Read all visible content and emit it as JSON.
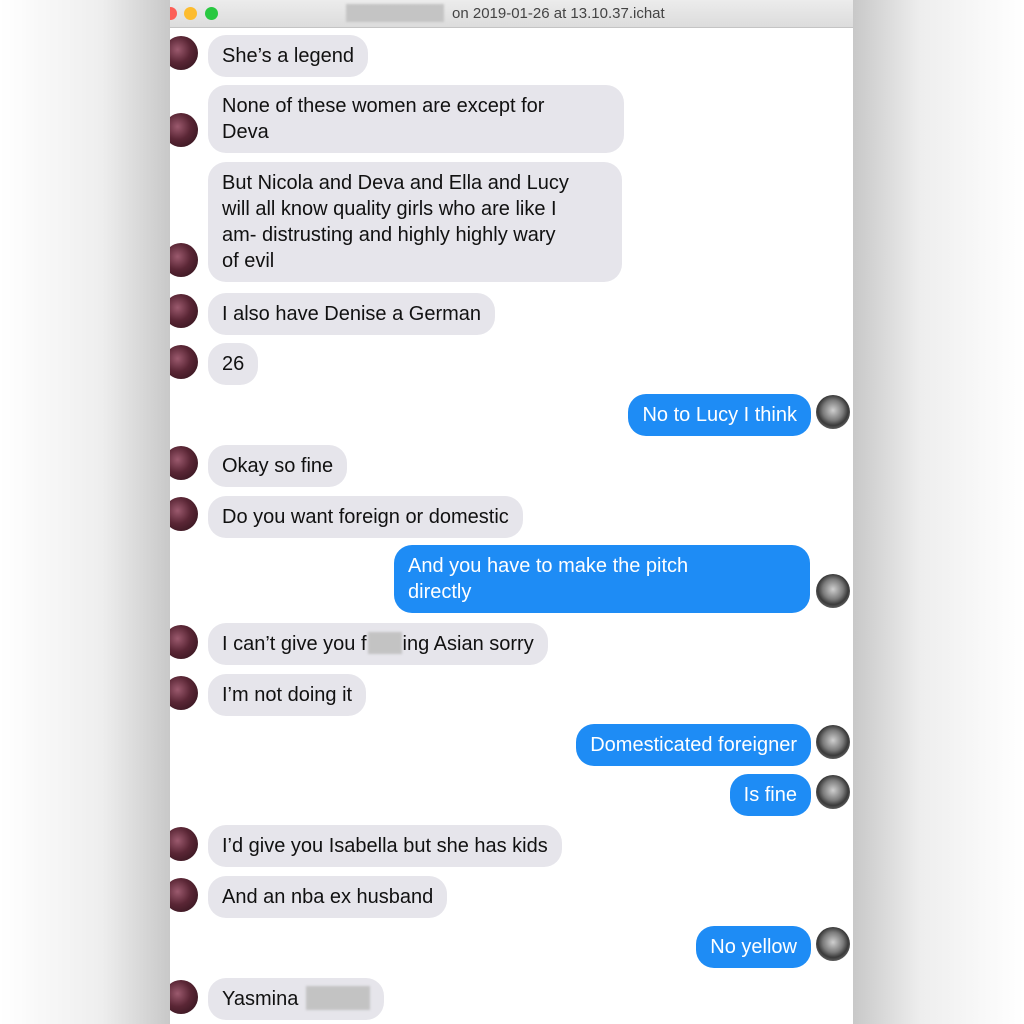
{
  "window": {
    "title": "on 2019-01-26 at 13.10.37.ichat"
  },
  "messages": [
    {
      "from": "them",
      "text": "She’s a legend"
    },
    {
      "from": "them",
      "text": "None of these women are except for\nDeva"
    },
    {
      "from": "them",
      "text": "But Nicola and Deva and Ella and Lucy\nwill all know quality girls who are like I\nam- distrusting and highly highly wary\nof evil"
    },
    {
      "from": "them",
      "text": "I also have Denise a German"
    },
    {
      "from": "them",
      "text": "26"
    },
    {
      "from": "me",
      "text": "No to Lucy I think"
    },
    {
      "from": "them",
      "text": "Okay so fine"
    },
    {
      "from": "them",
      "text": "Do you want foreign or domestic"
    },
    {
      "from": "me",
      "text": "And you have to make the pitch\ndirectly"
    },
    {
      "from": "them",
      "text_before": "I can’t give you f",
      "text_after": "ing Asian sorry"
    },
    {
      "from": "them",
      "text": "I’m not doing it"
    },
    {
      "from": "me",
      "text": "Domesticated foreigner"
    },
    {
      "from": "me",
      "text": "Is fine"
    },
    {
      "from": "them",
      "text": "I’d give you Isabella but she has  kids"
    },
    {
      "from": "them",
      "text": "And an nba ex husband"
    },
    {
      "from": "me",
      "text": "No yellow"
    },
    {
      "from": "them",
      "text": "Yasmina"
    }
  ],
  "colors": {
    "incoming_bubble": "#e6e5eb",
    "outgoing_bubble": "#1e8cf5"
  }
}
